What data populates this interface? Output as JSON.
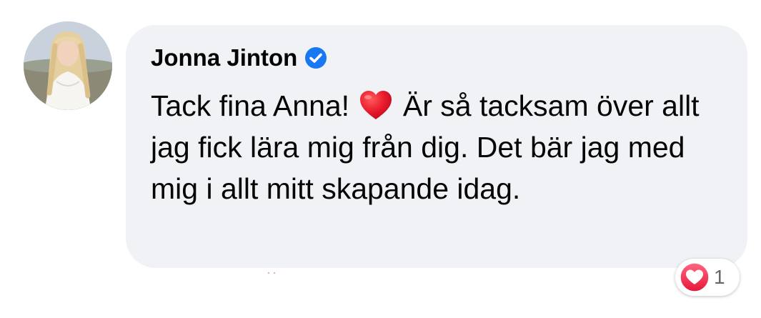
{
  "comment": {
    "author": "Jonna Jinton",
    "verified": true,
    "text_part1": "Tack fina Anna!",
    "text_part2": "Är så tacksam över allt jag fick lära mig från dig. Det bär jag med mig i allt mitt skapande idag.",
    "inline_emoji": "heart-emoji"
  },
  "reactions": {
    "type": "love",
    "count": "1"
  },
  "colors": {
    "bubble": "#f0f2f5",
    "verified": "#1877f2",
    "love": "#f33e58",
    "text": "#050505",
    "muted": "#65676b"
  }
}
